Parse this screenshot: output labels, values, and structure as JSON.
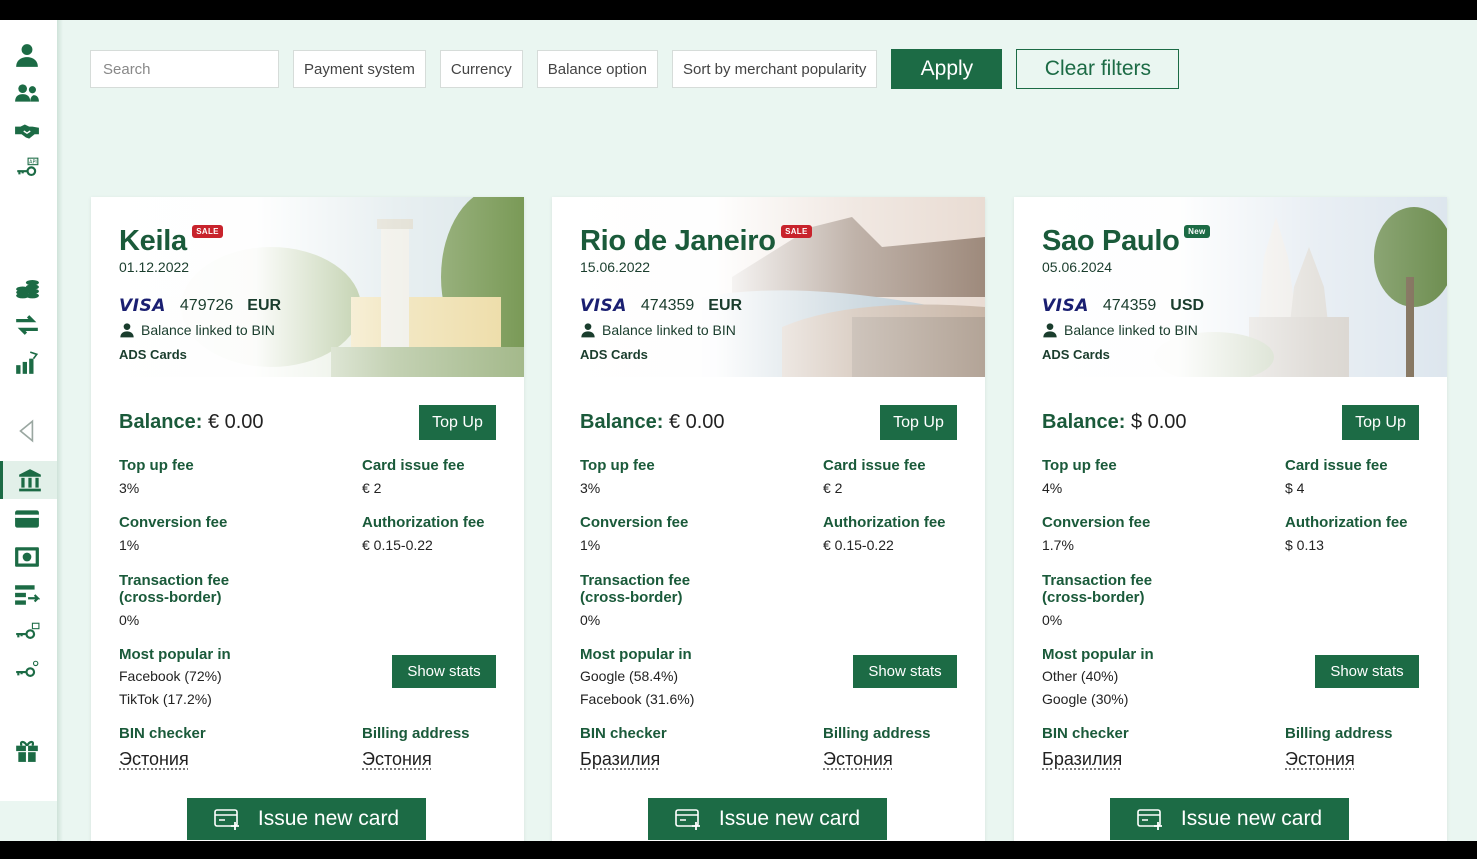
{
  "filters": {
    "search_placeholder": "Search",
    "payment_system": "Payment system",
    "currency": "Currency",
    "balance_option": "Balance option",
    "sort": "Sort by merchant popularity",
    "apply_label": "Apply",
    "clear_label": "Clear filters"
  },
  "sidebar": {
    "icons": [
      "user-icon",
      "users-icon",
      "handshake-icon",
      "api-key-icon",
      "coins-icon",
      "transfer-icon",
      "chart-icon",
      "collapse-icon",
      "bank-icon",
      "card-icon",
      "cash-icon",
      "list-transfer-icon",
      "key-icon",
      "key-alt-icon",
      "gift-icon"
    ],
    "active": "bank-icon"
  },
  "labels": {
    "balance": "Balance:",
    "top_up": "Top Up",
    "top_up_fee": "Top up fee",
    "card_issue_fee": "Card issue fee",
    "conversion_fee": "Conversion fee",
    "authorization_fee": "Authorization fee",
    "transaction_fee_1": "Transaction fee",
    "transaction_fee_2": "(cross-border)",
    "most_popular": "Most popular in",
    "show_stats": "Show stats",
    "bin_checker": "BIN checker",
    "billing_address": "Billing address",
    "issue_new_card": "Issue new card",
    "linked": "Balance linked to BIN",
    "provider": "ADS Cards",
    "visa": "VISA"
  },
  "cards": [
    {
      "city": "Keila",
      "badge": "SALE",
      "date": "01.12.2022",
      "bin": "479726",
      "currency": "EUR",
      "balance": "€ 0.00",
      "top_up_fee": "3%",
      "card_issue_fee": "€ 2",
      "conversion_fee": "1%",
      "authorization_fee": "€ 0.15-0.22",
      "transaction_fee": "0%",
      "popular_1": "Facebook (72%)",
      "popular_2": "TikTok (17.2%)",
      "bin_checker": "Эстония",
      "billing_address": "Эстония"
    },
    {
      "city": "Rio de Janeiro",
      "badge": "SALE",
      "date": "15.06.2022",
      "bin": "474359",
      "currency": "EUR",
      "balance": "€ 0.00",
      "top_up_fee": "3%",
      "card_issue_fee": "€ 2",
      "conversion_fee": "1%",
      "authorization_fee": "€ 0.15-0.22",
      "transaction_fee": "0%",
      "popular_1": "Google (58.4%)",
      "popular_2": "Facebook (31.6%)",
      "bin_checker": "Бразилия",
      "billing_address": "Эстония"
    },
    {
      "city": "Sao Paulo",
      "badge": "New",
      "date": "05.06.2024",
      "bin": "474359",
      "currency": "USD",
      "balance": "$ 0.00",
      "top_up_fee": "4%",
      "card_issue_fee": "$ 4",
      "conversion_fee": "1.7%",
      "authorization_fee": "$ 0.13",
      "transaction_fee": "0%",
      "popular_1": "Other (40%)",
      "popular_2": "Google (30%)",
      "bin_checker": "Бразилия",
      "billing_address": "Эстония"
    }
  ]
}
